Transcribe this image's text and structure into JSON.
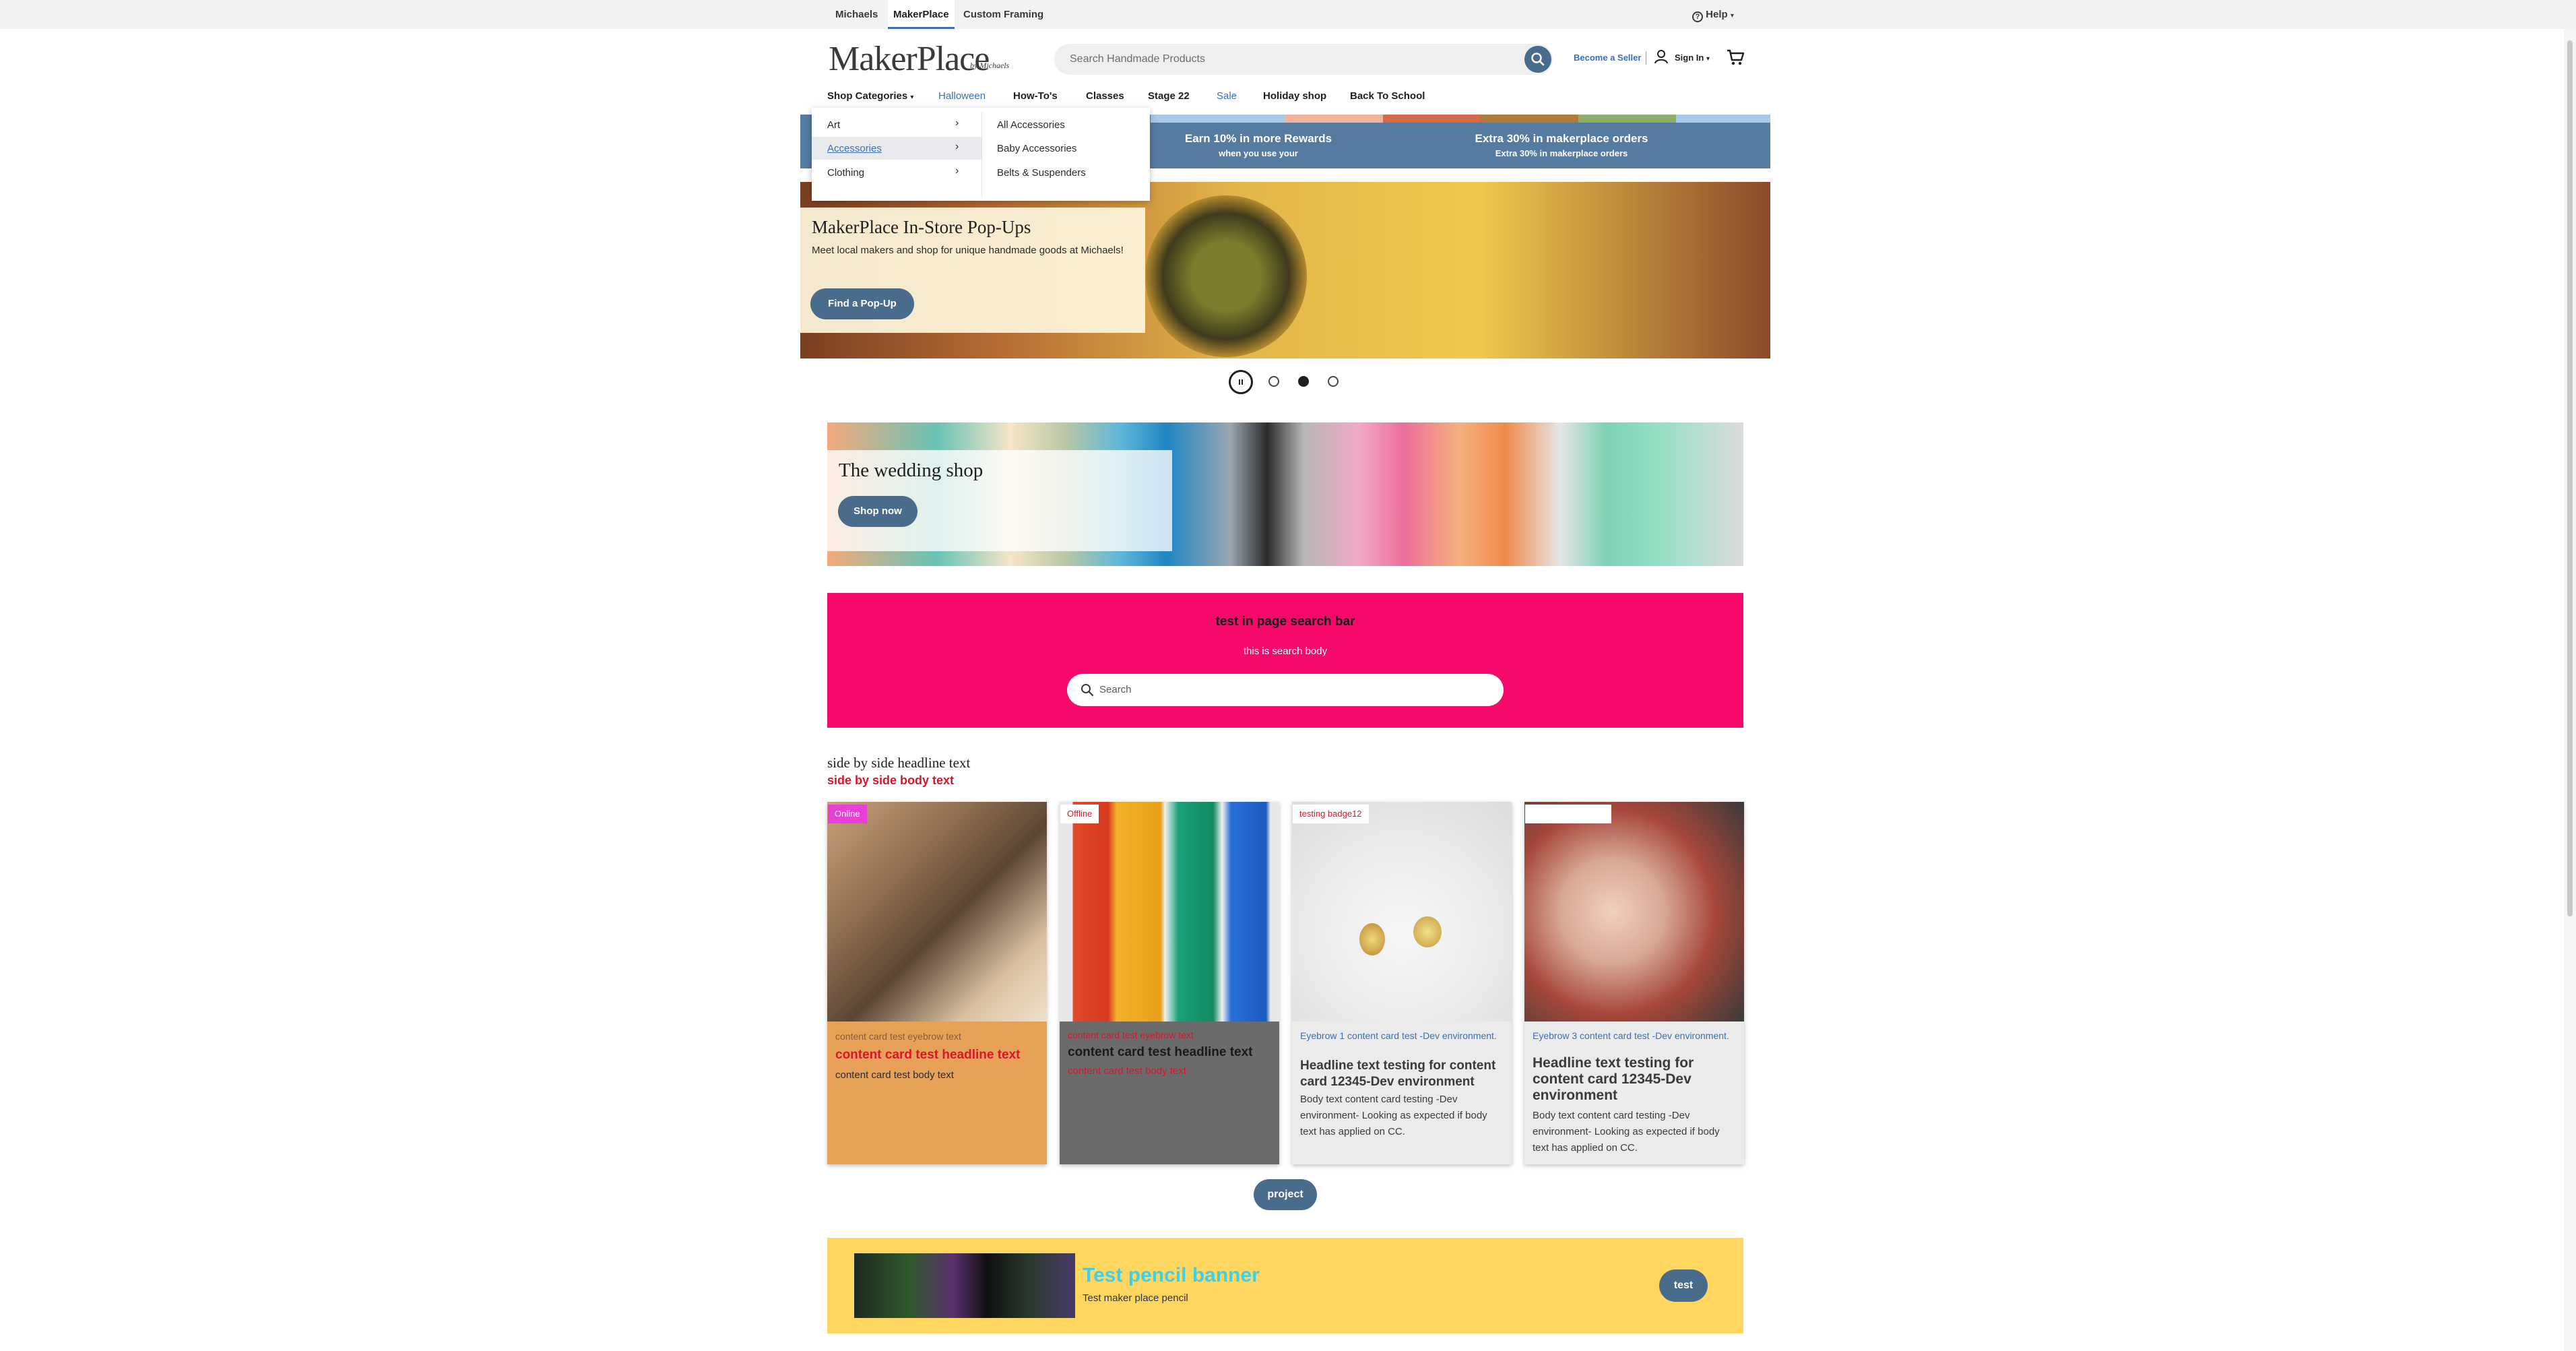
{
  "top_bar": {
    "links": [
      "Michaels",
      "MakerPlace",
      "Custom Framing"
    ],
    "help": "Help"
  },
  "header": {
    "logo": "MakerPlace",
    "logo_by": "by Michaels",
    "search_placeholder": "Search Handmade Products",
    "become_seller": "Become a Seller",
    "sign_in": "Sign In"
  },
  "nav": {
    "items": [
      "Shop Categories",
      "Halloween",
      "How-To's",
      "Classes",
      "Stage 22",
      "Sale",
      "Holiday shop",
      "Back To School"
    ]
  },
  "dropdown": {
    "categories": [
      "Art",
      "Accessories",
      "Clothing"
    ],
    "selected": "Accessories",
    "subitems": [
      "All Accessories",
      "Baby Accessories",
      "Belts & Suspenders"
    ]
  },
  "promo": {
    "items": [
      {
        "title": "Earn 10% in more Rewards",
        "sub": "when you use your"
      },
      {
        "title": "Extra 30% in makerplace orders",
        "sub": "Extra 30% in makerplace orders"
      }
    ]
  },
  "hero": {
    "title": "MakerPlace In-Store Pop-Ups",
    "body": "Meet local makers and shop for unique handmade goods at Michaels!",
    "button": "Find a Pop-Up",
    "slides": 4,
    "active_slide": 3
  },
  "wedding": {
    "title": "The wedding shop",
    "button": "Shop now"
  },
  "page_search": {
    "title": "test in page search bar",
    "body": "this is search body",
    "placeholder": "Search"
  },
  "side_by_side": {
    "headline": "side by side headline text",
    "body": "side by side body text"
  },
  "cards": [
    {
      "badge": "Online",
      "badge_bg": "#e83fd8",
      "badge_color": "#ffffff",
      "bg": "#e8a158",
      "eyebrow": "content card test eyebrow text",
      "eyebrow_color": "#8a5a30",
      "headline": "content card test headline text",
      "headline_color": "#d9152c",
      "body": "content card test body text",
      "body_color": "#2b2b2b",
      "image": "woman-with-laptop"
    },
    {
      "badge": "Offline",
      "badge_bg": "#ffffff",
      "badge_color": "#d9152c",
      "bg": "#6b6b6b",
      "eyebrow": "content card test eyebrow text",
      "eyebrow_color": "#d9152c",
      "headline": "content card test headline text",
      "headline_color": "#1a1a1a",
      "body": "content card test body text",
      "body_color": "#d9152c",
      "image": "vinyl-rolls"
    },
    {
      "badge": "testing badge12",
      "badge_bg": "#ffffff",
      "badge_color": "#d9152c",
      "bg": "#ebebeb",
      "eyebrow": "Eyebrow 1 content card test -Dev environment.",
      "eyebrow_color": "#3b6fb4",
      "headline": "Headline text testing for content card 12345-Dev environment",
      "headline_color": "#3a3a3a",
      "body": "Body text content card testing -Dev environment- Looking as expected if body text has applied on CC.",
      "body_color": "#3a3a3a",
      "image": "gold-lockets"
    },
    {
      "badge": "",
      "badge_bg": "#ffffff",
      "badge_color": "#d9152c",
      "bg": "#ebebeb",
      "eyebrow": "Eyebrow 3 content card test -Dev environment.",
      "eyebrow_color": "#3b6fb4",
      "headline": "Headline text testing for content card 12345-Dev environment",
      "headline_color": "#3a3a3a",
      "body": "Body text content card testing -Dev environment- Looking as expected if body text has applied on CC.",
      "body_color": "#3a3a3a",
      "image": "beading-hands"
    }
  ],
  "project_button": "project",
  "pencil": {
    "title": "Test pencil banner",
    "subtitle": "Test maker place pencil",
    "button": "test"
  },
  "colors": {
    "accent_blue": "#4a6c8c",
    "link_blue": "#3b6fb4",
    "pink": "#f5096a",
    "red": "#d9152c",
    "yellow": "#ffd760"
  }
}
